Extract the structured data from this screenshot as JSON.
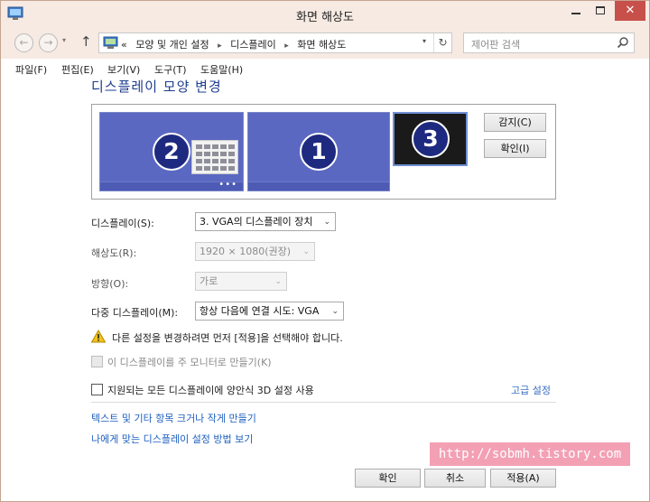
{
  "window": {
    "title": "화면 해상도",
    "minimize_glyph": "",
    "maximize_glyph": "",
    "close_glyph": "✕"
  },
  "nav": {
    "back_glyph": "←",
    "forward_glyph": "→",
    "dropdown_glyph": "▾",
    "up_glyph": "↑",
    "breadcrumb": [
      "«",
      "모양 및 개인 설정",
      "디스플레이",
      "화면 해상도"
    ],
    "breadcrumb_sep": "▸",
    "address_dropdown_glyph": "▾",
    "refresh_glyph": "↻",
    "search_placeholder": "제어판 검색"
  },
  "menu": [
    "파일(F)",
    "편집(E)",
    "보기(V)",
    "도구(T)",
    "도움말(H)"
  ],
  "content": {
    "title": "디스플레이 모양 변경",
    "monitors": [
      {
        "number": "2",
        "dots": "•••"
      },
      {
        "number": "1"
      },
      {
        "number": "3"
      }
    ],
    "detect_button": "감지(C)",
    "identify_button": "확인(I)",
    "display_label": "디스플레이(S):",
    "display_value": "3. VGA의 디스플레이 장치",
    "resolution_label": "해상도(R):",
    "resolution_value": "1920 × 1080(권장)",
    "orientation_label": "방향(O):",
    "orientation_value": "가로",
    "multi_label": "다중 디스플레이(M):",
    "multi_value": "항상 다음에 연결 시도: VGA",
    "select_arrow": "⌄",
    "warning_text": "다른 설정을 변경하려면 먼저 [적용]을 선택해야 합니다.",
    "main_monitor_checkbox": "이 디스플레이를 주 모니터로 만들기(K)",
    "stereo_checkbox": "지원되는 모든 디스플레이에 양안식 3D 설정 사용",
    "advanced_link": "고급 설정",
    "link_text_size": "텍스트 및 기타 항목 크거나 작게 만들기",
    "link_help": "나에게 맞는 디스플레이 설정 방법 보기"
  },
  "watermark": "http://sobmh.tistory.com",
  "buttons": {
    "ok": "확인",
    "cancel": "취소",
    "apply": "적용(A)"
  },
  "colors": {
    "titlebar": "#f6eae2",
    "accent_title": "#1e3d8f",
    "link": "#1d5fc0",
    "monitor": "#5a68c2",
    "close": "#c7514a"
  }
}
